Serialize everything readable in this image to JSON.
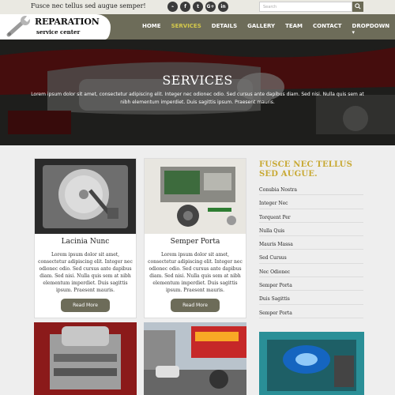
{
  "topbar": {
    "tagline": "Fusce nec tellus sed augue semper!",
    "social": [
      {
        "icon": "rss-icon",
        "glyph": "⌁"
      },
      {
        "icon": "facebook-icon",
        "glyph": "f"
      },
      {
        "icon": "twitter-icon",
        "glyph": "t"
      },
      {
        "icon": "google-plus-icon",
        "glyph": "G+"
      },
      {
        "icon": "linkedin-icon",
        "glyph": "in"
      }
    ],
    "search_placeholder": "Search"
  },
  "logo": {
    "title": "REPARATION",
    "subtitle": "service center"
  },
  "nav": {
    "items": [
      "HOME",
      "SERVICES",
      "DETAILS",
      "GALLERY",
      "TEAM",
      "CONTACT",
      "DROPDOWN ▾"
    ],
    "active_index": 1
  },
  "hero": {
    "title": "SERVICES",
    "text": "Lorem ipsum dolor sit amet, consectetur adipiscing elit. Integer nec odionec odio. Sed cursus ante dapibus diam. Sed nisi. Nulla quis sem at nibh elementum imperdiet. Duis sagittis ipsum. Praesent mauris."
  },
  "cards": [
    {
      "title": "Lacinia Nunc",
      "text": "Lorem ipsum dolor sit amet, consectetur adipiscing elit. Integer nec odionec odio. Sed cursus ante dapibus diam. Sed nisi. Nulla quis sem at nibh elementum imperdiet. Duis sagittis ipsum. Praesent mauris.",
      "button": "Read More"
    },
    {
      "title": "Semper Porta",
      "text": "Lorem ipsum dolor sit amet, consectetur adipiscing elit. Integer nec odionec odio. Sed cursus ante dapibus diam. Sed nisi. Nulla quis sem at nibh elementum imperdiet. Duis sagittis ipsum. Praesent mauris.",
      "button": "Read More"
    }
  ],
  "sidebar": {
    "title": "FUSCE NEC TELLUS SED AUGUE.",
    "items": [
      "Conubia Nostra",
      "Integer Nec",
      "Torquent Per",
      "Nulla Quis",
      "Mauris Massa",
      "Sed Cursus",
      "Nec Odionec",
      "Semper Porta",
      "Duis Sagittis",
      "Semper Porta"
    ]
  },
  "colors": {
    "brand": "#6d6c59",
    "accent": "#c8a934",
    "active_nav": "#d4c94b"
  }
}
